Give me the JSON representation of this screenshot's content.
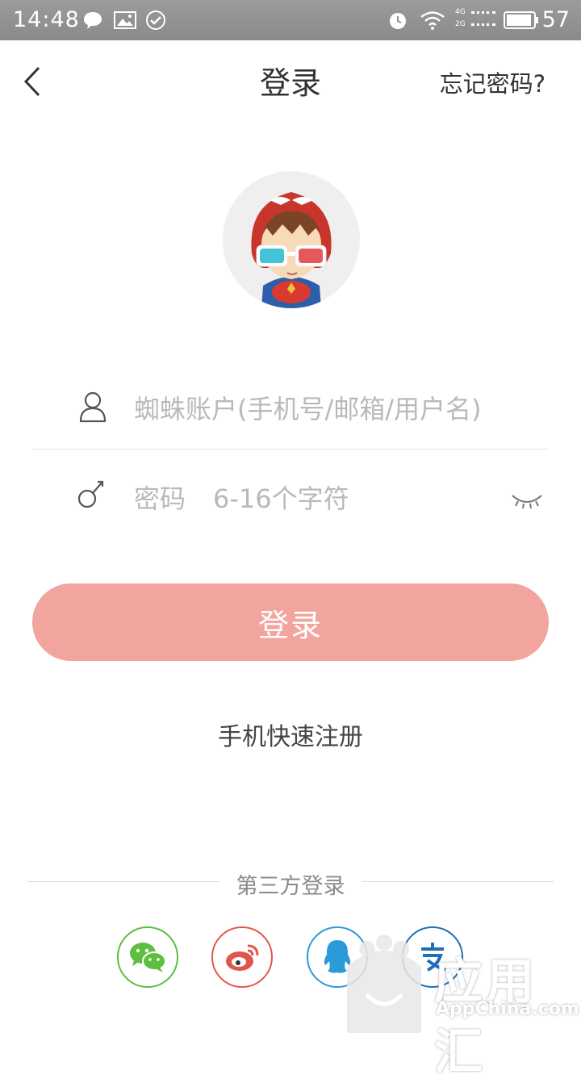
{
  "status_bar": {
    "time": "14:48",
    "battery": "57",
    "network_top": "4G",
    "network_bottom": "2G"
  },
  "nav": {
    "title": "登录",
    "forgot_password": "忘记密码?"
  },
  "form": {
    "account_placeholder": "蜘蛛账户(手机号/邮箱/用户名)",
    "password_label": "密码",
    "password_placeholder": "6-16个字符"
  },
  "login_button": "登录",
  "register_link": "手机快速注册",
  "third_party": {
    "label": "第三方登录",
    "providers": [
      "wechat-icon",
      "weibo-icon",
      "qq-icon",
      "alipay-icon"
    ]
  },
  "watermark": {
    "title": "应用汇",
    "subtitle": "AppChina.com"
  },
  "colors": {
    "accent": "#f2a49e",
    "wechat": "#5cbf3f",
    "weibo": "#e2574c",
    "qq": "#2a9ad8",
    "alipay": "#1f6fb8"
  }
}
